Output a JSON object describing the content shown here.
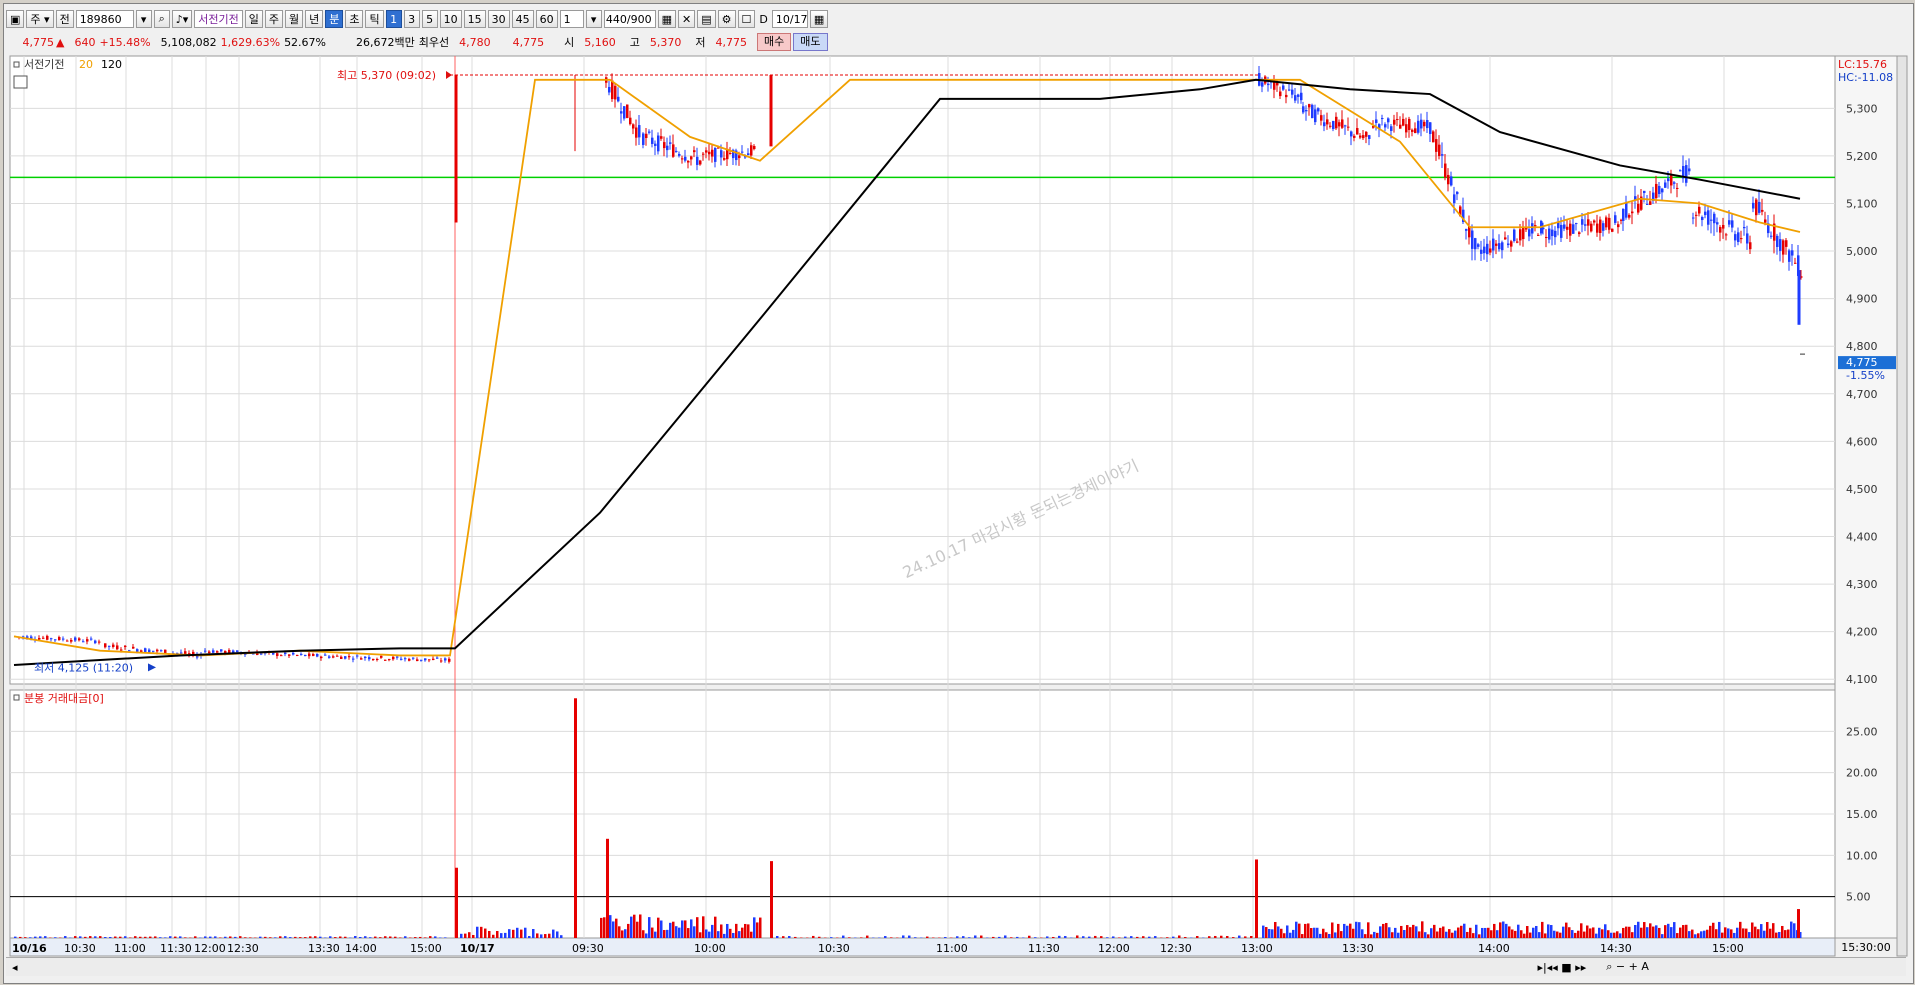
{
  "toolbar": {
    "period": "주",
    "prefix": "전",
    "code": "189860",
    "name": "서전기전",
    "tf": [
      "일",
      "주",
      "월",
      "년",
      "분",
      "초",
      "틱"
    ],
    "min_steps": [
      "1",
      "3",
      "5",
      "10",
      "15",
      "30",
      "45",
      "60"
    ],
    "unit": "1",
    "count": "440/900",
    "date_flag": "D",
    "date": "10/17"
  },
  "info": {
    "price": "4,775",
    "arrow": "▲",
    "change": "640",
    "change_pct": "+15.48%",
    "volume": "5,108,082",
    "vol_ratio": "1,629.63%",
    "turnover": "52.67%",
    "amount": "26,672백만",
    "best_label": "최우선",
    "ask": "4,780",
    "bid": "4,775",
    "open_label": "시",
    "open": "5,160",
    "high_label": "고",
    "high": "5,370",
    "low_label": "저",
    "low": "4,775",
    "buy": "매수",
    "sell": "매도"
  },
  "price_panel": {
    "legend_name": "서전기전",
    "ma1": "20",
    "ma2": "120",
    "lc": "LC:15.76",
    "hc": "HC:-11.08",
    "high_ann": "최고 5,370 (09:02)",
    "low_ann": "최저 4,125 (11:20)",
    "current_price": "4,775",
    "current_pct": "-1.55%",
    "y_ticks": [
      "5,300",
      "5,200",
      "5,100",
      "5,000",
      "4,900",
      "4,800",
      "4,700",
      "4,600",
      "4,500",
      "4,400",
      "4,300",
      "4,200",
      "4,100"
    ],
    "watermark": "24.10.17 마감시황 돈되는경제이야기"
  },
  "volume_panel": {
    "legend": "분봉 거래대금[0]",
    "y_ticks": [
      "25.00",
      "20.00",
      "15.00",
      "10.00",
      "5.00"
    ]
  },
  "x_axis": {
    "labels": [
      "10/16",
      "10:30",
      "11:00",
      "11:30",
      "12:00",
      "12:30",
      "13:30",
      "14:00",
      "15:00",
      "10/17",
      "09:30",
      "10:00",
      "10:30",
      "11:00",
      "11:30",
      "12:00",
      "12:30",
      "13:00",
      "13:30",
      "14:00",
      "14:30",
      "15:00"
    ],
    "end_label": "15:30:00"
  },
  "colors": {
    "up": "#e60000",
    "down": "#1e3cff",
    "ma20": "#f0a000",
    "ma120": "#000000",
    "hline": "#00d000",
    "grid": "#dcdcdc"
  },
  "chart_data": {
    "type": "candlestick",
    "ylim": [
      4090,
      5410
    ],
    "ref_line": 5155,
    "price_high": 5370,
    "price_low": 4125,
    "candles_summary": [
      {
        "t": "10/16 10:30",
        "o": 4190,
        "h": 4195,
        "l": 4180,
        "c": 4185
      },
      {
        "t": "10/16 15:00",
        "o": 4140,
        "h": 4150,
        "l": 4135,
        "c": 4135
      },
      {
        "t": "10/17 09:00",
        "o": 5160,
        "h": 5370,
        "l": 5060,
        "c": 5370
      },
      {
        "t": "10/17 13:00",
        "o": 5370,
        "h": 5370,
        "l": 5270,
        "c": 5300
      },
      {
        "t": "10/17 14:00",
        "o": 5000,
        "h": 5050,
        "l": 4980,
        "c": 5000
      },
      {
        "t": "10/17 15:00",
        "o": 5240,
        "h": 5240,
        "l": 5000,
        "c": 5120
      },
      {
        "t": "10/17 15:19",
        "o": 4960,
        "h": 4960,
        "l": 4845,
        "c": 4845
      }
    ],
    "ma20": [
      4190,
      4160,
      4150,
      4160,
      4150,
      4150,
      5360,
      5360,
      5240,
      5190,
      5360,
      5360,
      5360,
      5360,
      5360,
      5230,
      5050,
      5050,
      5110,
      5100,
      5060,
      5040
    ],
    "ma120": [
      4130,
      4150,
      4160,
      4165,
      4165,
      4165,
      4450,
      4870,
      5320,
      5320,
      5320,
      5340,
      5360,
      5340,
      5330,
      5250,
      5180,
      5150,
      5110
    ],
    "volume_ylim": [
      0,
      30
    ],
    "volume_peaks": [
      {
        "t": "10/17 09:00",
        "v": 8.5
      },
      {
        "t": "10/17 09:30",
        "v": 29.0
      },
      {
        "t": "10/17 09:40",
        "v": 12.0
      },
      {
        "t": "10/17 10:30",
        "v": 9.3
      },
      {
        "t": "10/17 13:00",
        "v": 9.5
      },
      {
        "t": "10/17 15:00",
        "v": 3.5
      }
    ],
    "volume_ref": 5.0
  }
}
